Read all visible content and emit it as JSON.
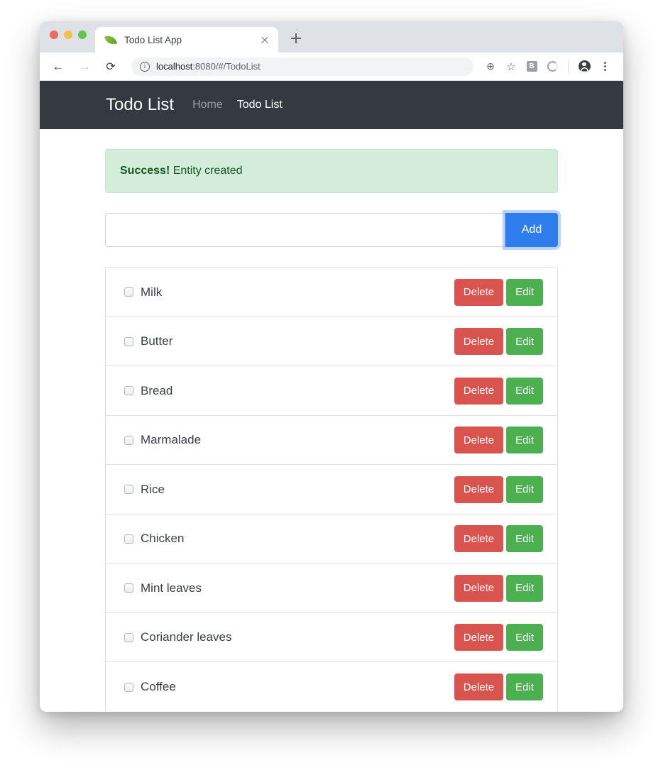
{
  "browser": {
    "tab": {
      "title": "Todo List App",
      "favicon": "leaf-icon",
      "close": "×"
    },
    "new_tab_label": "+",
    "nav": {
      "back": "←",
      "forward": "→",
      "reload": "⟳"
    },
    "omnibox": {
      "info_icon": "info-icon",
      "url_host": "localhost",
      "url_path": ":8080/#/TodoList"
    },
    "toolbar_icons": {
      "zoom": "⊕",
      "bookmark": "☆",
      "bitwarden": "B",
      "extension": "ring-icon",
      "profile": "account-icon",
      "menu": "⋮"
    }
  },
  "navbar": {
    "brand": "Todo List",
    "links": [
      {
        "label": "Home",
        "active": false
      },
      {
        "label": "Todo List",
        "active": true
      }
    ]
  },
  "alert": {
    "strong": "Success!",
    "message": " Entity created"
  },
  "form": {
    "input_value": "",
    "input_placeholder": "",
    "add_label": "Add"
  },
  "actions": {
    "delete_label": "Delete",
    "edit_label": "Edit"
  },
  "todos": [
    {
      "label": "Milk",
      "checked": false
    },
    {
      "label": "Butter",
      "checked": false
    },
    {
      "label": "Bread",
      "checked": false
    },
    {
      "label": "Marmalade",
      "checked": false
    },
    {
      "label": "Rice",
      "checked": false
    },
    {
      "label": "Chicken",
      "checked": false
    },
    {
      "label": "Mint leaves",
      "checked": false
    },
    {
      "label": "Coriander leaves",
      "checked": false
    },
    {
      "label": "Coffee",
      "checked": false
    }
  ],
  "colors": {
    "navbar_bg": "#343a40",
    "alert_bg": "#d4edda",
    "alert_text": "#155724",
    "add_button": "#2f7ced",
    "delete_button": "#d9534f",
    "edit_button": "#4caf50"
  }
}
